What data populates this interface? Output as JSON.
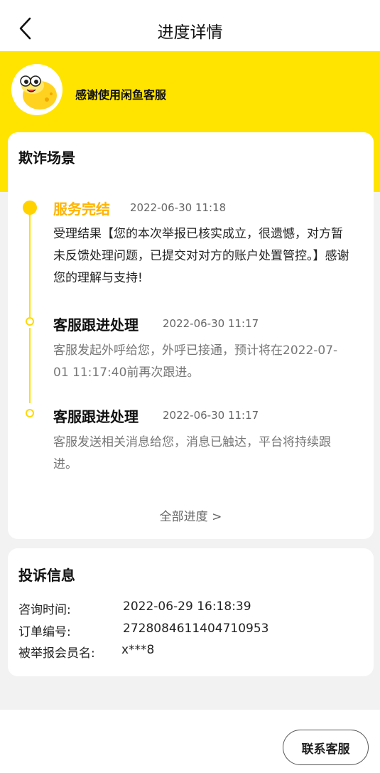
{
  "header": {
    "title": "进度详情",
    "back_icon": "chevron-left-icon"
  },
  "banner": {
    "welcome": "感谢使用闲鱼客服",
    "mascot_icon": "xianyu-mascot-icon",
    "color": "#ffe400"
  },
  "scene_card": {
    "title": "欺诈场景",
    "timeline": [
      {
        "title": "服务完结",
        "time": "2022-06-30 11:18",
        "desc": "受理结果【您的本次举报已核实成立，很遗憾，对方暂未反馈处理问题，已提交对对方的账户处置管控。】感谢您的理解与支持!",
        "highlight_color": "#ffb400"
      },
      {
        "title": "客服跟进处理",
        "time": "2022-06-30 11:17",
        "desc": "客服发起外呼给您，外呼已接通，预计将在2022-07-01 11:17:40前再次跟进。"
      },
      {
        "title": "客服跟进处理",
        "time": "2022-06-30 11:17",
        "desc": "客服发送相关消息给您，消息已触达，平台将持续跟进。"
      }
    ],
    "all_progress": "全部进度 >"
  },
  "complaint_card": {
    "title": "投诉信息",
    "rows": [
      {
        "label": "咨询时间:",
        "value": "2022-06-29 16:18:39"
      },
      {
        "label": "订单编号:",
        "value": "2728084611404710953"
      },
      {
        "label": "被举报会员名:",
        "value": "x***8"
      }
    ]
  },
  "footer": {
    "contact_label": "联系客服"
  }
}
